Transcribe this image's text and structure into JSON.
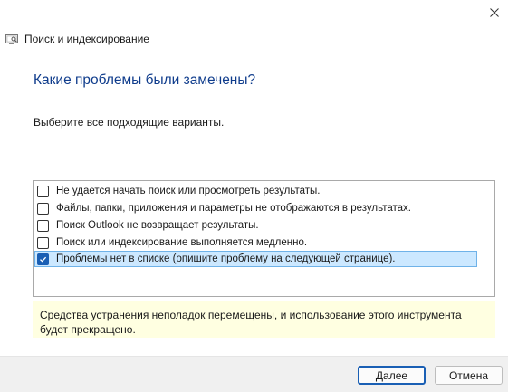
{
  "window": {
    "title": "Поиск и индексирование"
  },
  "main": {
    "heading": "Какие проблемы были замечены?",
    "instruction": "Выберите все подходящие варианты."
  },
  "options": [
    {
      "label": "Не удается начать поиск или просмотреть результаты.",
      "checked": false
    },
    {
      "label": "Файлы, папки, приложения и параметры не отображаются в результатах.",
      "checked": false
    },
    {
      "label": "Поиск Outlook не возвращает результаты.",
      "checked": false
    },
    {
      "label": "Поиск или индексирование выполняется медленно.",
      "checked": false
    },
    {
      "label": "Проблемы нет в списке (опишите проблему на следующей странице).",
      "checked": true
    }
  ],
  "notice": {
    "text": "Средства устранения неполадок перемещены, и использование этого инструмента будет прекращено."
  },
  "buttons": {
    "next": "Далее",
    "cancel": "Отмена"
  },
  "colors": {
    "heading": "#0f3c8c",
    "accent": "#1a5fb4",
    "selection": "#cce8ff",
    "notice_bg": "#ffffe1"
  }
}
